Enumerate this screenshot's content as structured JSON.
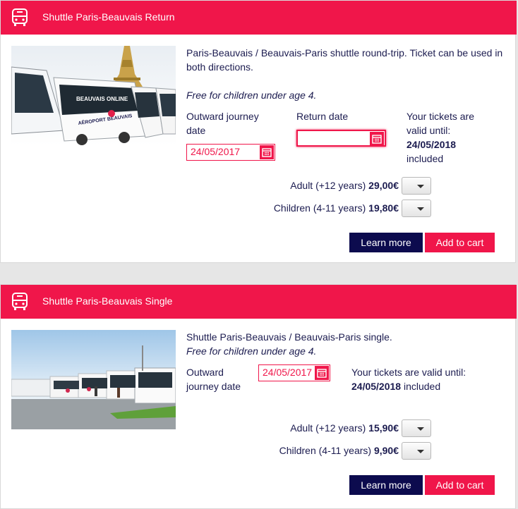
{
  "products": [
    {
      "title": "Shuttle Paris-Beauvais Return",
      "description": "Paris-Beauvais / Beauvais-Paris shuttle round-trip. Ticket can be used in both directions.",
      "note": "Free for children under age 4.",
      "outward_label_1": "Outward journey",
      "outward_label_2": "date",
      "outward_value": "24/05/2017",
      "return_label": "Return date",
      "return_value": "",
      "valid_1": "Your tickets are",
      "valid_2": "valid until:",
      "valid_date": "24/05/2018",
      "valid_suffix": "included",
      "adult_label": "Adult (+12 years)",
      "adult_price": "29,00€",
      "children_label": "Children (4-11 years)",
      "children_price": "19,80€",
      "learn_more": "Learn more",
      "add_to_cart": "Add to cart"
    },
    {
      "title": "Shuttle Paris-Beauvais Single",
      "description": "Shuttle Paris-Beauvais / Beauvais-Paris single.",
      "note": "Free for children under age 4.",
      "outward_label_1": "Outward",
      "outward_label_2": "journey date",
      "outward_value": "24/05/2017",
      "valid_1": "Your tickets are valid until:",
      "valid_date": "24/05/2018",
      "valid_suffix": " included",
      "adult_label": "Adult (+12 years)",
      "adult_price": "15,90€",
      "children_label": "Children (4-11 years)",
      "children_price": "9,90€",
      "learn_more": "Learn more",
      "add_to_cart": "Add to cart"
    }
  ],
  "photo_signage": [
    "AÉROPORT BEAUVAIS",
    "BEAUVAIS ONLINE"
  ],
  "colors": {
    "brand": "#f0164a",
    "dark": "#0c0b4e",
    "text": "#1c1c50"
  },
  "icons": [
    "bus-icon",
    "calendar-icon",
    "chevron-down-icon"
  ]
}
